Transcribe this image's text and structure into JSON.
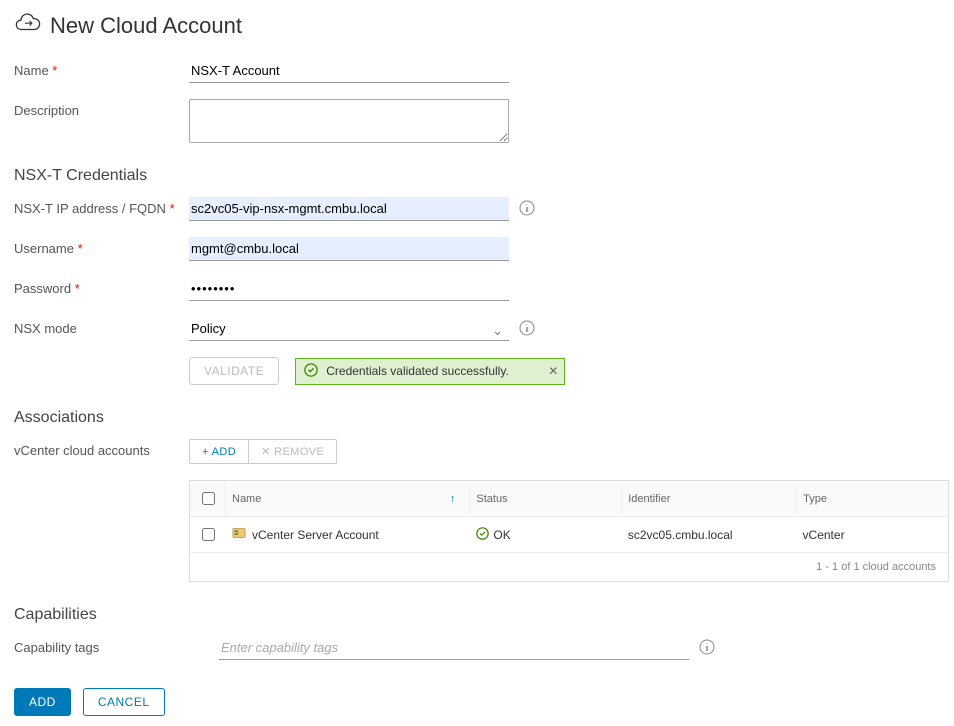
{
  "page": {
    "title": "New Cloud Account"
  },
  "form": {
    "name_label": "Name",
    "name_value": "NSX-T Account",
    "description_label": "Description",
    "description_value": ""
  },
  "credentials": {
    "section_title": "NSX-T Credentials",
    "fqdn_label": "NSX-T IP address / FQDN",
    "fqdn_value": "sc2vc05-vip-nsx-mgmt.cmbu.local",
    "username_label": "Username",
    "username_value": "mgmt@cmbu.local",
    "password_label": "Password",
    "password_value": "••••••••",
    "mode_label": "NSX mode",
    "mode_value": "Policy",
    "validate_button": "Validate",
    "validate_message": "Credentials validated successfully."
  },
  "associations": {
    "section_title": "Associations",
    "label": "vCenter cloud accounts",
    "add_button": "+ ADD",
    "remove_button": "✕ REMOVE",
    "columns": {
      "name": "Name",
      "status": "Status",
      "identifier": "Identifier",
      "type": "Type"
    },
    "rows": [
      {
        "name": "vCenter Server Account",
        "status": "OK",
        "identifier": "sc2vc05.cmbu.local",
        "type": "vCenter"
      }
    ],
    "footer": "1 - 1 of 1 cloud accounts"
  },
  "capabilities": {
    "section_title": "Capabilities",
    "tags_label": "Capability tags",
    "tags_placeholder": "Enter capability tags"
  },
  "actions": {
    "add": "Add",
    "cancel": "Cancel"
  }
}
